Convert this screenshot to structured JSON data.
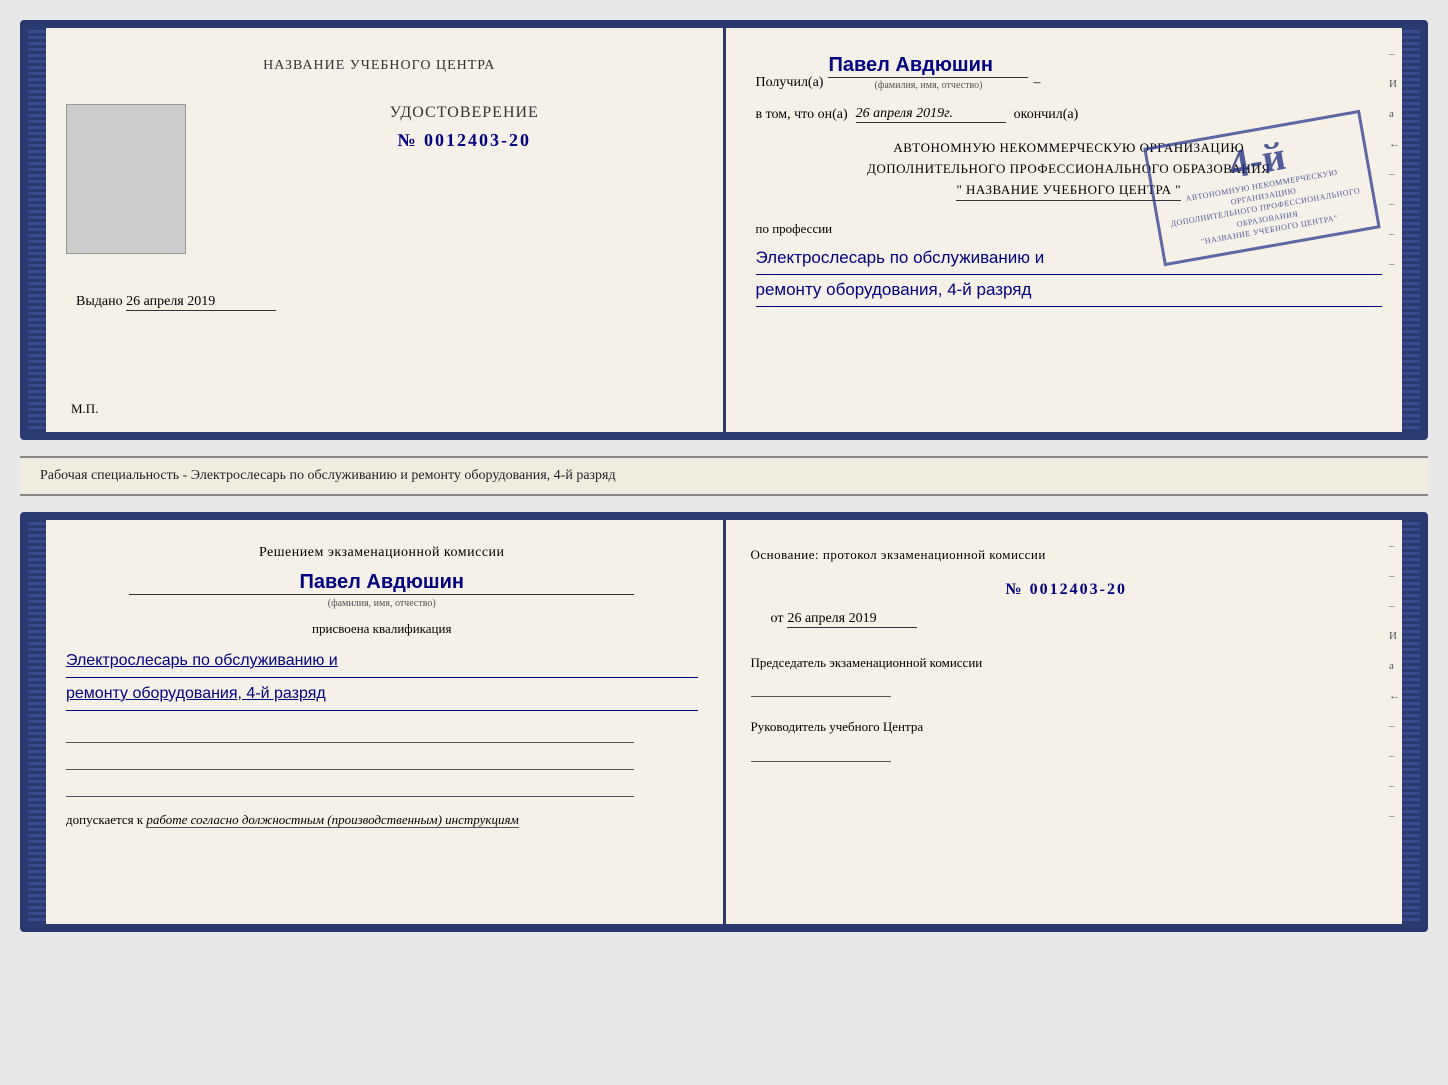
{
  "doc_top": {
    "left_page": {
      "title": "НАЗВАНИЕ УЧЕБНОГО ЦЕНТРА",
      "cert_label": "УДОСТОВЕРЕНИЕ",
      "cert_number": "№ 0012403-20",
      "issued_label": "Выдано",
      "issued_date": "26 апреля 2019",
      "mp_label": "М.П."
    },
    "right_page": {
      "recipient_label": "Получил(а)",
      "recipient_name": "Павел Авдюшин",
      "fio_sublabel": "(фамилия, имя, отчество)",
      "fact_prefix": "в том, что он(а)",
      "fact_date": "26 апреля 2019г.",
      "fact_suffix": "окончил(а)",
      "org_line1": "АВТОНОМНУЮ НЕКОММЕРЧЕСКУЮ ОРГАНИЗАЦИЮ",
      "org_line2": "ДОПОЛНИТЕЛЬНОГО ПРОФЕССИОНАЛЬНОГО ОБРАЗОВАНИЯ",
      "org_name": "\" НАЗВАНИЕ УЧЕБНОГО ЦЕНТРА \"",
      "profession_label": "по профессии",
      "profession_text": "Электрослесарь по обслуживанию и",
      "profession_text2": "ремонту оборудования, 4-й разряд",
      "stamp_grade": "4-й",
      "stamp_text1": "АВ ТОНОМНУЮ НЕК ОМ РЧЕ СКУЮ ОРГАНИЗАЦИЮ",
      "stamp_text2": "ДОПОЛНИТЕЛЬНОГО ПРОФЕССИОНАЛЬНОГО ОБРАЗОВАНИЯ",
      "stamp_text3": "НАЗВАНИЕ УЧЕБНОГО ЦЕНТРА"
    }
  },
  "middle_text": "Рабочая специальность - Электрослесарь по обслуживанию и ремонту оборудования, 4-й разряд",
  "doc_bottom": {
    "left_page": {
      "commission_title": "Решением экзаменационной комиссии",
      "person_name": "Павел Авдюшин",
      "fio_sublabel": "(фамилия, имя, отчество)",
      "qualification_label": "присвоена квалификация",
      "qualification_text": "Электрослесарь по обслуживанию и",
      "qualification_text2": "ремонту оборудования, 4-й разряд",
      "допускается_label": "допускается к",
      "допускается_text": "работе согласно должностным (производственным) инструкциям"
    },
    "right_page": {
      "basis_label": "Основание: протокол экзаменационной комиссии",
      "protocol_number": "№ 0012403-20",
      "date_prefix": "от",
      "date_value": "26 апреля 2019",
      "chairman_label": "Председатель экзаменационной комиссии",
      "director_label": "Руководитель учебного Центра"
    }
  },
  "side_marks": [
    "И",
    "а",
    "←",
    "–",
    "–",
    "–",
    "–",
    "–"
  ]
}
